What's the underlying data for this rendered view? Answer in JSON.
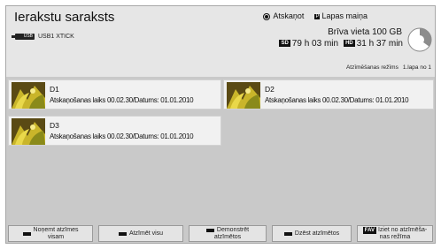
{
  "header": {
    "title": "Ierakstu saraksts",
    "device_label": "USB1 XTICK",
    "usb_badge": "USB",
    "mode_option_mark": "Atskaņot",
    "page_key": "P",
    "page_option": "Lapas maiņa",
    "free_space": "Brīva vieta 100 GB",
    "sd_badge": "SD",
    "sd_time": "79 h 03 min",
    "hd_badge": "HD",
    "hd_time": "31 h 37 min",
    "mode_status": "Atzīmēšanas režīms",
    "page_indicator": "1.lapa no 1",
    "storage_used_fraction": 0.35
  },
  "items": [
    {
      "name": "D1",
      "info": "Atskaņošanas laiks 00.02.30/Datums: 01.01.2010"
    },
    {
      "name": "D2",
      "info": "Atskaņošanas laiks 00.02.30/Datums: 01.01.2010"
    },
    {
      "name": "D3",
      "info": "Atskaņošanas laiks 00.02.30/Datums: 01.01.2010"
    }
  ],
  "buttons": {
    "b1_line1": "Noņemt atzīmes",
    "b1_line2": "visam",
    "b2": "Atzīmēt visu",
    "b3_line1": "Demonstrēt",
    "b3_line2": "atzīmētos",
    "b4": "Dzēst atzīmētos",
    "fav_badge": "FAV",
    "b5_line1": "Iziet no atzīmēša-",
    "b5_line2": "nas režīma"
  }
}
